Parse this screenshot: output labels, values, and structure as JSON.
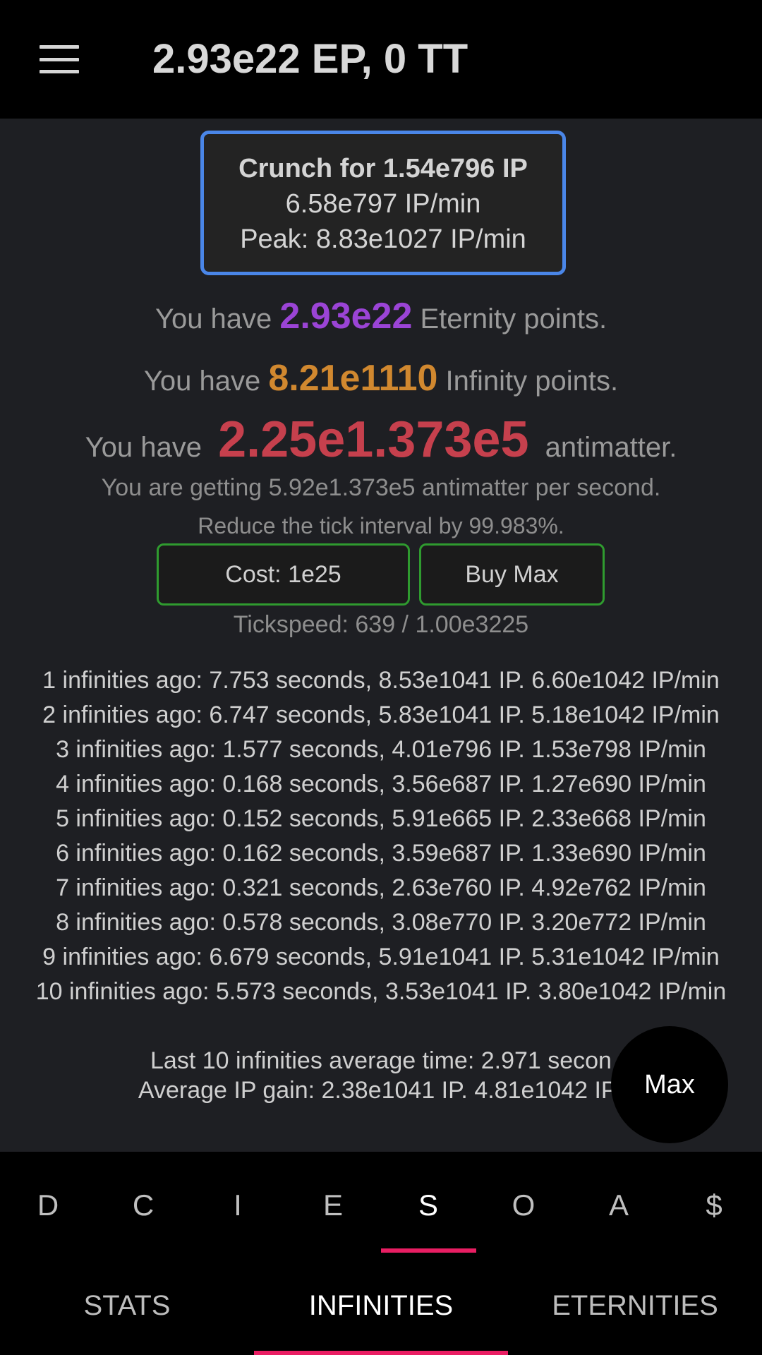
{
  "header": {
    "title": "2.93e22 EP, 0 TT",
    "menu_icon": "hamburger-menu-icon"
  },
  "crunch": {
    "line1": "Crunch for 1.54e796 IP",
    "line2": "6.58e797 IP/min",
    "line3": "Peak: 8.83e1027 IP/min"
  },
  "eternity": {
    "prefix": "You have ",
    "value": "2.93e22",
    "suffix": " Eternity points."
  },
  "infinity": {
    "prefix": "You have ",
    "value": "8.21e1110",
    "suffix": " Infinity points."
  },
  "antimatter": {
    "prefix": "You have ",
    "value": "2.25e1.373e5",
    "suffix": " antimatter."
  },
  "rate_text": "You are getting 5.92e1.373e5 antimatter per second.",
  "tick_text": "Reduce the tick interval by 99.983%.",
  "buttons": {
    "cost_label": "Cost: 1e25",
    "buy_max_label": "Buy Max"
  },
  "tickspeed_text": "Tickspeed: 639 / 1.00e3225",
  "history": [
    "1 infinities ago: 7.753 seconds, 8.53e1041 IP. 6.60e1042 IP/min",
    "2 infinities ago: 6.747 seconds, 5.83e1041 IP. 5.18e1042 IP/min",
    "3 infinities ago: 1.577 seconds, 4.01e796 IP. 1.53e798 IP/min",
    "4 infinities ago: 0.168 seconds, 3.56e687 IP. 1.27e690 IP/min",
    "5 infinities ago: 0.152 seconds, 5.91e665 IP. 2.33e668 IP/min",
    "6 infinities ago: 0.162 seconds, 3.59e687 IP. 1.33e690 IP/min",
    "7 infinities ago: 0.321 seconds, 2.63e760 IP. 4.92e762 IP/min",
    "8 infinities ago: 0.578 seconds, 3.08e770 IP. 3.20e772 IP/min",
    "9 infinities ago: 6.679 seconds, 5.91e1041 IP. 5.31e1042 IP/min",
    "10 infinities ago: 5.573 seconds, 3.53e1041 IP. 3.80e1042 IP/min"
  ],
  "average": {
    "time_text": "Last 10 infinities average time: 2.971 secon",
    "gain_text": "Average IP gain: 2.38e1041 IP. 4.81e1042 IP/"
  },
  "fab_label": "Max",
  "tabs": [
    "D",
    "C",
    "I",
    "E",
    "S",
    "O",
    "A",
    "$"
  ],
  "active_tab": "S",
  "subtabs": [
    "STATS",
    "INFINITIES",
    "ETERNITIES"
  ],
  "active_subtab": "INFINITIES",
  "colors": {
    "accent_pink": "#e91e63",
    "eternity_purple": "#9b44d6",
    "infinity_orange": "#d1882f",
    "antimatter_red": "#c6404d",
    "crunch_border_blue": "#4a86e8",
    "button_border_green": "#2f9b2f"
  }
}
